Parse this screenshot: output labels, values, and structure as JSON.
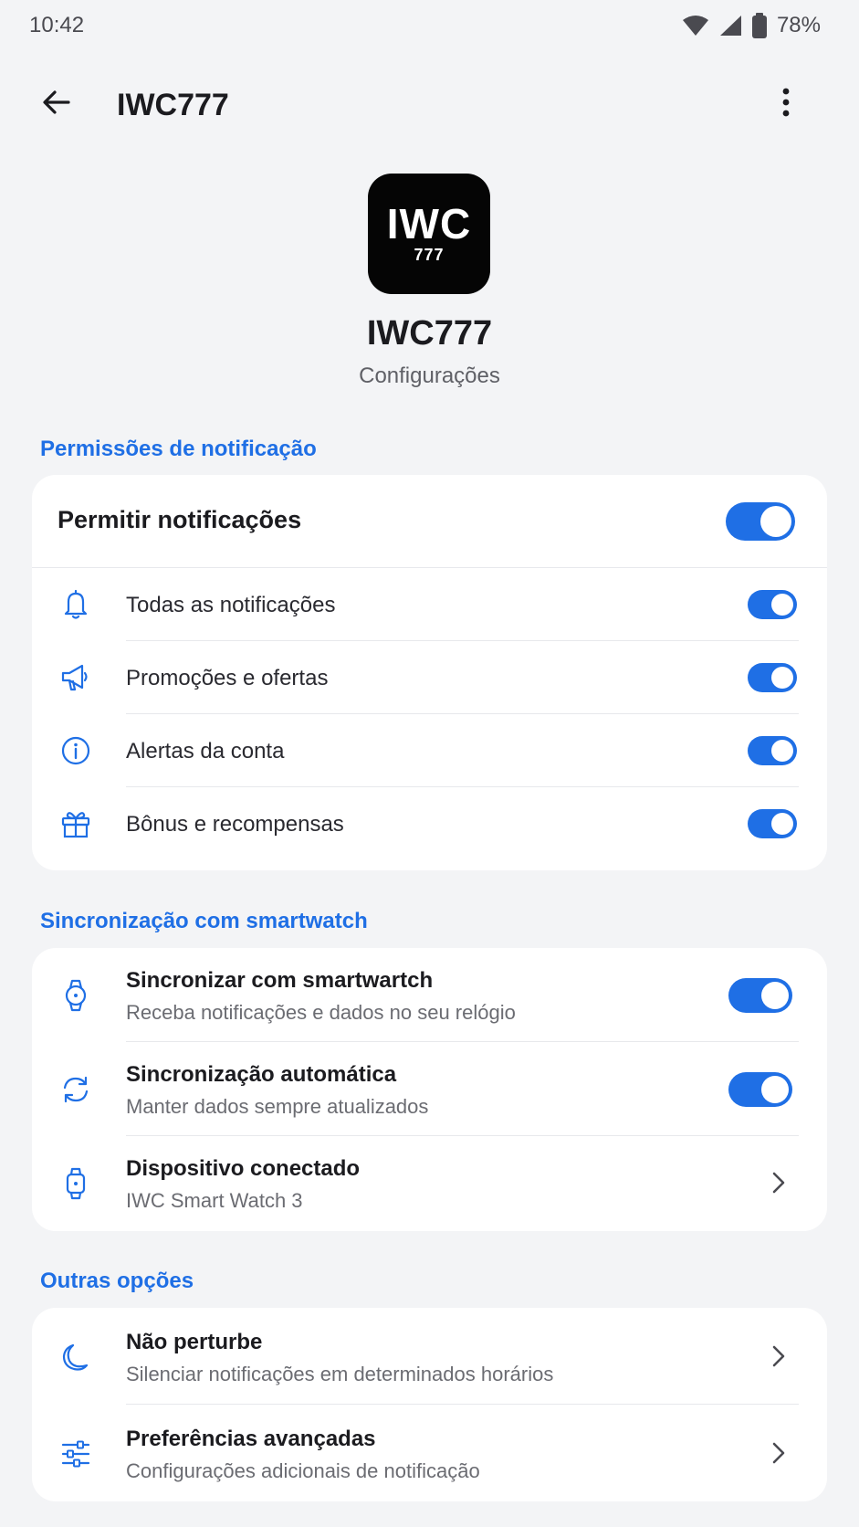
{
  "status_bar": {
    "time": "10:42",
    "battery": "78%",
    "icons": [
      "wifi-icon",
      "signal-icon",
      "battery-icon"
    ]
  },
  "top_bar": {
    "title": "IWC777",
    "back_icon": "arrow-left-icon",
    "more_icon": "more-vertical-icon"
  },
  "app": {
    "logo_main": "IWC",
    "logo_sub": "777",
    "name": "IWC777",
    "subtitle": "Configurações"
  },
  "sections": {
    "notifications": {
      "title": "Permissões de notificação",
      "master": {
        "label": "Permitir notificações",
        "enabled": true
      },
      "items": [
        {
          "label": "Todas as notificações",
          "icon": "bell-icon",
          "enabled": true
        },
        {
          "label": "Promoções e ofertas",
          "icon": "megaphone-icon",
          "enabled": true
        },
        {
          "label": "Alertas da conta",
          "icon": "info-icon",
          "enabled": true
        },
        {
          "label": "Bônus e recompensas",
          "icon": "gift-icon",
          "enabled": true
        }
      ]
    },
    "smartwatch": {
      "title": "Sincronização com smartwatch",
      "items": [
        {
          "title": "Sincronizar com smartwartch",
          "subtitle": "Receba notificações e dados no seu relógio",
          "icon": "watch-icon",
          "enabled": true
        },
        {
          "title": "Sincronização automática",
          "subtitle": "Manter dados sempre atualizados",
          "icon": "sync-icon",
          "enabled": true
        },
        {
          "title": "Dispositivo conectado",
          "subtitle": "IWC Smart Watch 3",
          "icon": "smartwatch-icon"
        }
      ]
    },
    "other": {
      "title": "Outras opções",
      "items": [
        {
          "title": "Não perturbe",
          "subtitle": "Silenciar notificações em determinados horários",
          "icon": "moon-icon"
        },
        {
          "title": "Preferências avançadas",
          "subtitle": "Configurações adicionais de notificação",
          "icon": "sliders-icon"
        }
      ]
    }
  },
  "colors": {
    "accent": "#1f6fe5",
    "background": "#f3f4f6",
    "card": "#ffffff",
    "text_primary": "#1b1b1f",
    "text_secondary": "#6b6c72"
  }
}
